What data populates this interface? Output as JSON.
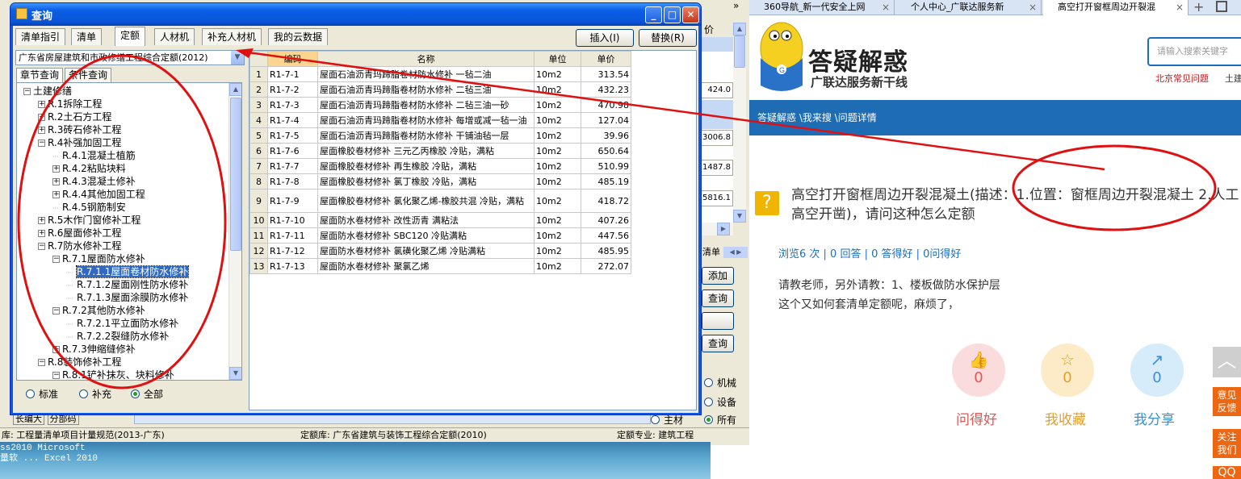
{
  "bg_app": {
    "tabs_arrow": "»",
    "price_col_header": "价",
    "cells": [
      "424.0",
      "3006.8",
      "1487.8",
      "5816.1"
    ],
    "side_labels": [
      "清单",
      "添加",
      "查询",
      "查询"
    ],
    "side_radios": [
      "机械",
      "设备",
      "所有",
      "主材"
    ],
    "scroll_labels": [
      "长编大",
      "分部码"
    ],
    "status_lib": "库: 工程量清单项目计量规范(2013-广东)",
    "status_quota": "定额库: 广东省建筑与装饰工程综合定额(2010)",
    "status_major": "定额专业: 建筑工程"
  },
  "desktop": {
    "line1": "ss2010  Microsoft",
    "line2": "量软 ...  Excel 2010"
  },
  "dialog": {
    "title": "查询",
    "tabs": [
      "清单指引",
      "清单",
      "定额",
      "人材机",
      "补充人材机",
      "我的云数据"
    ],
    "active_tab": "定额",
    "insert_button": "插入(I)",
    "replace_button": "替换(R)",
    "quota_library": "广东省房屋建筑和市政修缮工程综合定额(2012)",
    "subtabs": [
      "章节查询",
      "条件查询"
    ],
    "tree": [
      {
        "label": "土建修缮",
        "level": 0,
        "pm": "−"
      },
      {
        "label": "R.1拆除工程",
        "level": 1,
        "pm": "+"
      },
      {
        "label": "R.2土石方工程",
        "level": 1,
        "pm": "+"
      },
      {
        "label": "R.3砖石修补工程",
        "level": 1,
        "pm": "+"
      },
      {
        "label": "R.4补强加固工程",
        "level": 1,
        "pm": "−"
      },
      {
        "label": "R.4.1混凝土植筋",
        "level": 2,
        "pm": ""
      },
      {
        "label": "R.4.2粘贴块料",
        "level": 2,
        "pm": "+"
      },
      {
        "label": "R.4.3混凝土修补",
        "level": 2,
        "pm": "+"
      },
      {
        "label": "R.4.4其他加固工程",
        "level": 2,
        "pm": "+"
      },
      {
        "label": "R.4.5钢筋制安",
        "level": 2,
        "pm": ""
      },
      {
        "label": "R.5木作门窗修补工程",
        "level": 1,
        "pm": "+"
      },
      {
        "label": "R.6屋面修补工程",
        "level": 1,
        "pm": "+"
      },
      {
        "label": "R.7防水修补工程",
        "level": 1,
        "pm": "−"
      },
      {
        "label": "R.7.1屋面防水修补",
        "level": 2,
        "pm": "−"
      },
      {
        "label": "R.7.1.1屋面卷材防水修补",
        "level": 3,
        "pm": "",
        "selected": true
      },
      {
        "label": "R.7.1.2屋面刚性防水修补",
        "level": 3,
        "pm": ""
      },
      {
        "label": "R.7.1.3屋面涂膜防水修补",
        "level": 3,
        "pm": ""
      },
      {
        "label": "R.7.2其他防水修补",
        "level": 2,
        "pm": "−"
      },
      {
        "label": "R.7.2.1平立面防水修补",
        "level": 3,
        "pm": ""
      },
      {
        "label": "R.7.2.2裂缝防水修补",
        "level": 3,
        "pm": ""
      },
      {
        "label": "R.7.3伸缩缝修补",
        "level": 2,
        "pm": "+"
      },
      {
        "label": "R.8装饰修补工程",
        "level": 1,
        "pm": "−"
      },
      {
        "label": "R.8.1铲补抹灰、块料修补",
        "level": 2,
        "pm": "−"
      }
    ],
    "filter_options": [
      "标准",
      "补充",
      "全部"
    ],
    "filter_selected": "全部",
    "columns": [
      "编码",
      "名称",
      "单位",
      "单价"
    ],
    "rows": [
      {
        "n": "1",
        "code": "R1-7-1",
        "name": "屋面石油沥青玛蹄脂卷材防水修补 一毡二油",
        "unit": "10m2",
        "price": "313.54"
      },
      {
        "n": "2",
        "code": "R1-7-2",
        "name": "屋面石油沥青玛蹄脂卷材防水修补 二毡三油",
        "unit": "10m2",
        "price": "432.23"
      },
      {
        "n": "3",
        "code": "R1-7-3",
        "name": "屋面石油沥青玛蹄脂卷材防水修补 二毡三油一砂",
        "unit": "10m2",
        "price": "470.98"
      },
      {
        "n": "4",
        "code": "R1-7-4",
        "name": "屋面石油沥青玛蹄脂卷材防水修补 每增或减一毡一油",
        "unit": "10m2",
        "price": "127.04"
      },
      {
        "n": "5",
        "code": "R1-7-5",
        "name": "屋面石油沥青玛蹄脂卷材防水修补 干铺油毡一层",
        "unit": "10m2",
        "price": "39.96"
      },
      {
        "n": "6",
        "code": "R1-7-6",
        "name": "屋面橡胶卷材修补 三元乙丙橡胶 冷贴，满粘",
        "unit": "10m2",
        "price": "650.64"
      },
      {
        "n": "7",
        "code": "R1-7-7",
        "name": "屋面橡胶卷材修补 再生橡胶 冷贴，满粘",
        "unit": "10m2",
        "price": "510.99"
      },
      {
        "n": "8",
        "code": "R1-7-8",
        "name": "屋面橡胶卷材修补 氯丁橡胶 冷贴，满粘",
        "unit": "10m2",
        "price": "485.19"
      },
      {
        "n": "9",
        "code": "R1-7-9",
        "name": "屋面橡胶卷材修补 氯化聚乙烯-橡胶共混 冷贴，满粘",
        "unit": "10m2",
        "price": "418.72"
      },
      {
        "n": "10",
        "code": "R1-7-10",
        "name": "屋面防水卷材修补 改性沥青 满粘法",
        "unit": "10m2",
        "price": "407.26"
      },
      {
        "n": "11",
        "code": "R1-7-11",
        "name": "屋面防水卷材修补 SBC120 冷贴满粘",
        "unit": "10m2",
        "price": "447.56"
      },
      {
        "n": "12",
        "code": "R1-7-12",
        "name": "屋面防水卷材修补 氯磺化聚乙烯 冷贴满粘",
        "unit": "10m2",
        "price": "485.95"
      },
      {
        "n": "13",
        "code": "R1-7-13",
        "name": "屋面防水卷材修补 聚氯乙烯",
        "unit": "10m2",
        "price": "272.07"
      }
    ]
  },
  "browser": {
    "tabs": [
      "360导航_新一代安全上网",
      "个人中心_广联达服务新",
      "高空打开窗框周边开裂混"
    ],
    "tab_close": "×",
    "new_tab": "+",
    "logo_title": "答疑解惑",
    "logo_subtitle": "广联达服务新干线",
    "search_placeholder": "请输入搜索关键字",
    "hot_link": "北京常见问题",
    "hot_link2": "土建",
    "breadcrumb": "答疑解惑 \\我来搜 \\问题详情",
    "question_title": "高空打开窗框周边开裂混凝土(描述：1.位置：窗框周边开裂混凝土 2.人工高空开凿)，请问这种怎么定额",
    "stats": "浏览6 次 | 0 回答 | 0 答得好 | 0问得好",
    "body_line1": "请教老师，另外请教：1、楼板做防水保护层",
    "body_line2": " 这个又如何套清单定额呢，麻烦了，",
    "actions": [
      {
        "label": "问得好",
        "count": "0",
        "icon": "👍"
      },
      {
        "label": "我收藏",
        "count": "0",
        "icon": "☆"
      },
      {
        "label": "我分享",
        "count": "0",
        "icon": "↗"
      }
    ],
    "side_buttons": [
      "意见反馈",
      "关注我们",
      "QQ"
    ]
  }
}
